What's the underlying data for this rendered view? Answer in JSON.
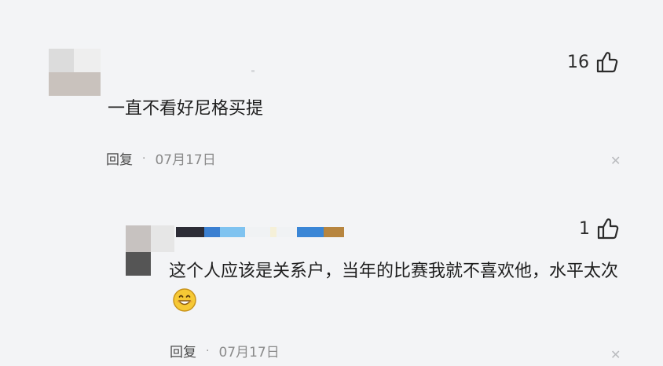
{
  "comments": [
    {
      "text": "一直不看好尼格买提",
      "reply_label": "回复",
      "separator": "·",
      "date": "07月17日",
      "likes": "16",
      "like_icon": "thumbs-up-outline",
      "close_icon": "close-x"
    },
    {
      "text": "这个人应该是关系户，当年的比赛我就不喜欢他，水平太次",
      "emoji": "grinning-face",
      "reply_label": "回复",
      "separator": "·",
      "date": "07月17日",
      "likes": "1",
      "like_icon": "thumbs-up-outline",
      "close_icon": "close-x"
    }
  ],
  "colors": {
    "background": "#f3f4f6",
    "text": "#1e1e1e",
    "meta": "#8a8a8a",
    "icon": "#2b2b2b"
  }
}
